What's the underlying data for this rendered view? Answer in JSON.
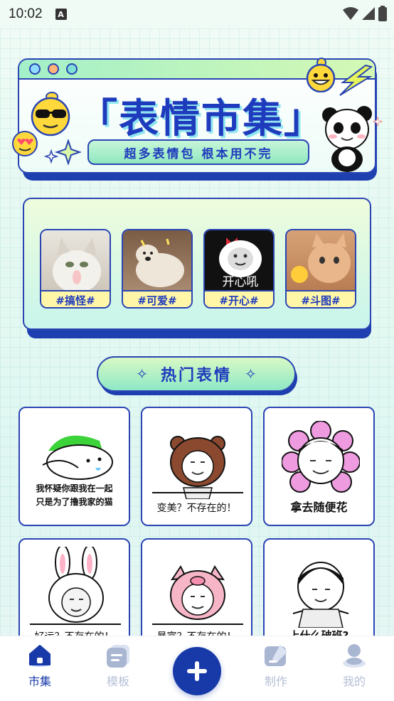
{
  "status_bar": {
    "time": "10:02",
    "notif_glyph": "A"
  },
  "banner": {
    "title": "「表情市集」",
    "subtitle": "超多表情包 根本用不完",
    "dot_colors": [
      "#8fdcff",
      "#ffb37a",
      "#7ee0d5"
    ]
  },
  "categories": [
    {
      "label": "#搞怪#",
      "icon": "cat-photo"
    },
    {
      "label": "#可爱#",
      "icon": "dog-photo"
    },
    {
      "label": "#开心#",
      "icon": "panda-meme",
      "image_caption": "开心吼"
    },
    {
      "label": "#斗图#",
      "icon": "kitten-photo"
    }
  ],
  "hot": {
    "title": "热门表情"
  },
  "memes": [
    {
      "caption": "我怀疑你跟我在一起\n只是为了撸我家的猫",
      "icon": "green-hat-blob"
    },
    {
      "caption": "变美？不存在的！",
      "icon": "bear-hood-face"
    },
    {
      "caption": "拿去随便花",
      "icon": "flower-face"
    },
    {
      "caption": "好运？不存在的！",
      "icon": "bunny-hood-face"
    },
    {
      "caption": "暴富？不存在的！",
      "icon": "pig-hood-face"
    },
    {
      "caption": "上什么破班?",
      "icon": "bowl-cut-face"
    }
  ],
  "nav": {
    "items": [
      {
        "label": "市集",
        "icon": "home-icon",
        "active": true
      },
      {
        "label": "模板",
        "icon": "template-icon",
        "active": false
      },
      {
        "label": "制作",
        "icon": "edit-icon",
        "active": false
      },
      {
        "label": "我的",
        "icon": "profile-icon",
        "active": false
      }
    ],
    "fab_icon": "plus-icon"
  },
  "colors": {
    "brand": "#1f3bbd",
    "nav_active": "#173aa8",
    "nav_inactive": "#b5bfd6",
    "accent_mint": "#90e8c0"
  }
}
